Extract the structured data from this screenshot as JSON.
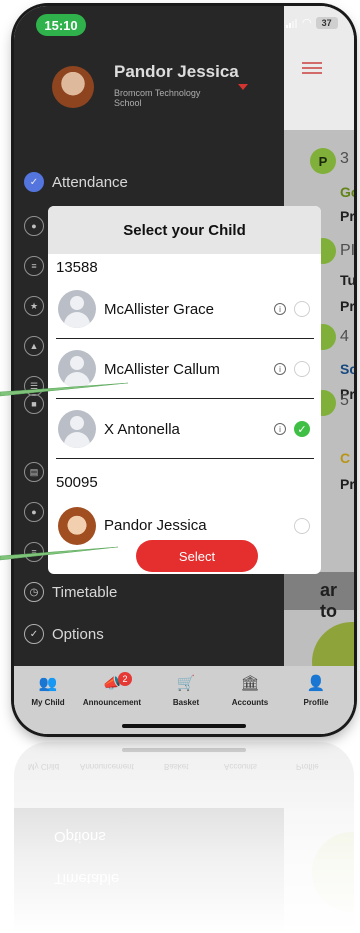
{
  "status_bar": {
    "time": "15:10",
    "battery": "37"
  },
  "drawer": {
    "user_name": "Pandor Jessica",
    "school": "Bromcom Technology School",
    "menu": {
      "attendance": "Attendance",
      "timetable": "Timetable",
      "options": "Options"
    }
  },
  "background_peek": {
    "bubble_letter": "P",
    "items": [
      "3",
      "Go",
      "Pr",
      "PI",
      "Tu",
      "Pr",
      "4",
      "Sc",
      "Pr",
      "5",
      "C",
      "Pr"
    ],
    "strip_text": "ar to"
  },
  "modal": {
    "title": "Select your Child",
    "groups": [
      {
        "id": "13588",
        "children": [
          {
            "name": "McAllister Grace",
            "selected": false
          },
          {
            "name": "McAllister Callum",
            "selected": false
          },
          {
            "name": "X Antonella",
            "selected": true
          }
        ]
      },
      {
        "id": "50095",
        "children": [
          {
            "name": "Pandor Jessica",
            "selected": false
          }
        ]
      }
    ],
    "select_button": "Select"
  },
  "bottom_nav": {
    "items": [
      {
        "label": "My Child",
        "icon": "family-icon",
        "active": true
      },
      {
        "label": "Announcement",
        "icon": "megaphone-icon",
        "badge": "2"
      },
      {
        "label": "Basket",
        "icon": "cart-icon"
      },
      {
        "label": "Accounts",
        "icon": "bank-icon"
      },
      {
        "label": "Profile",
        "icon": "person-icon"
      }
    ]
  },
  "colors": {
    "accent_red": "#e52e2e",
    "selected_green": "#3fbf45",
    "drawer_bg": "#2b2b2b",
    "active_nav_blue": "#2450a8",
    "callout_green": "#7fc47a"
  }
}
